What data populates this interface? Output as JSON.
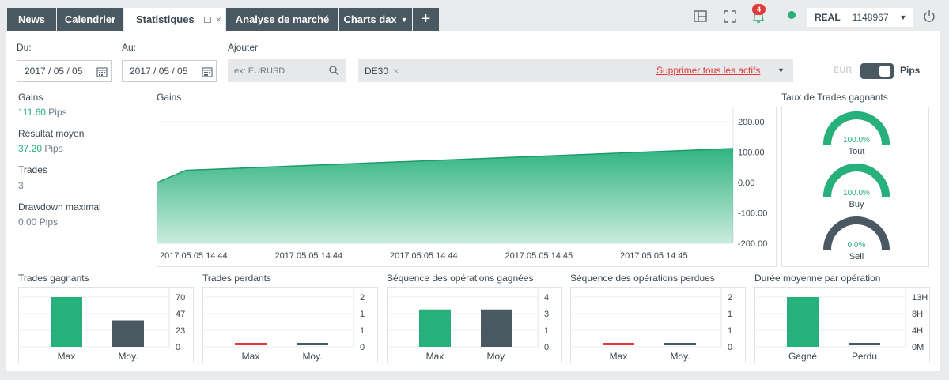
{
  "tabs": [
    {
      "label": "News"
    },
    {
      "label": "Calendrier"
    },
    {
      "label": "Statistiques"
    },
    {
      "label": "Analyse de marché"
    },
    {
      "label": "Charts dax"
    }
  ],
  "header": {
    "notification_count": "4",
    "account_type": "REAL",
    "account_number": "1148967"
  },
  "filters": {
    "from_label": "Du:",
    "from_value": "2017 / 05 / 05",
    "to_label": "Au:",
    "to_value": "2017 / 05 / 05",
    "add_label": "Ajouter",
    "add_placeholder": "ex: EURUSD",
    "selected_asset": "DE30",
    "remove_all_label": "Supprimer tous les actifs",
    "toggle_off_label": "EUR",
    "toggle_on_label": "Pips"
  },
  "summary": {
    "gains_label": "Gains",
    "gains_value": "111.60",
    "gains_unit": "Pips",
    "avg_label": "Résultat moyen",
    "avg_value": "37.20",
    "avg_unit": "Pips",
    "trades_label": "Trades",
    "trades_value": "3",
    "drawdown_label": "Drawdown maximal",
    "drawdown_value": "0.00 Pips"
  },
  "colors": {
    "green": "#26b07a",
    "dark": "#4a5862",
    "red": "#e23a3a",
    "tab_bg": "#4a5862"
  },
  "win_rate": {
    "title": "Taux de Trades gagnants",
    "gauges": [
      {
        "value": "100.0%",
        "label": "Tout",
        "fraction": 1.0
      },
      {
        "value": "100.0%",
        "label": "Buy",
        "fraction": 1.0
      },
      {
        "value": "0.0%",
        "label": "Sell",
        "fraction": 0.0
      }
    ]
  },
  "chart_data": [
    {
      "type": "area",
      "title": "Gains",
      "x": [
        "2017.05.05 14:44",
        "2017.05.05 14:44",
        "2017.05.05 14:44",
        "2017.05.05 14:45",
        "2017.05.05 14:45"
      ],
      "series": [
        {
          "values": [
            0,
            40,
            111.6
          ]
        }
      ],
      "yticks": [
        "200.00",
        "100.00",
        "0.00",
        "-100.00",
        "-200.00"
      ],
      "ylim": [
        -200,
        200
      ]
    },
    {
      "type": "bar",
      "title": "Trades gagnants",
      "categories": [
        "Max",
        "Moy."
      ],
      "values": [
        70,
        37.2
      ],
      "yticks": [
        "70",
        "47",
        "23",
        "0"
      ],
      "ylim": [
        0,
        70
      ]
    },
    {
      "type": "bar",
      "title": "Trades perdants",
      "categories": [
        "Max",
        "Moy."
      ],
      "values": [
        0,
        0
      ],
      "yticks": [
        "2",
        "1",
        "1",
        "0"
      ],
      "ylim": [
        0,
        2
      ]
    },
    {
      "type": "bar",
      "title": "Séquence des opérations gagnées",
      "categories": [
        "Max",
        "Moy."
      ],
      "values": [
        3,
        3
      ],
      "yticks": [
        "4",
        "3",
        "1",
        "0"
      ],
      "ylim": [
        0,
        4
      ]
    },
    {
      "type": "bar",
      "title": "Séquence des opérations perdues",
      "categories": [
        "Max",
        "Moy."
      ],
      "values": [
        0,
        0
      ],
      "yticks": [
        "2",
        "1",
        "1",
        "0"
      ],
      "ylim": [
        0,
        2
      ]
    },
    {
      "type": "bar",
      "title": "Durée moyenne par opération",
      "categories": [
        "Gagné",
        "Perdu"
      ],
      "values": [
        13,
        0
      ],
      "yticks": [
        "13H",
        "8H",
        "4H",
        "0M"
      ],
      "ylim": [
        0,
        13
      ]
    }
  ]
}
